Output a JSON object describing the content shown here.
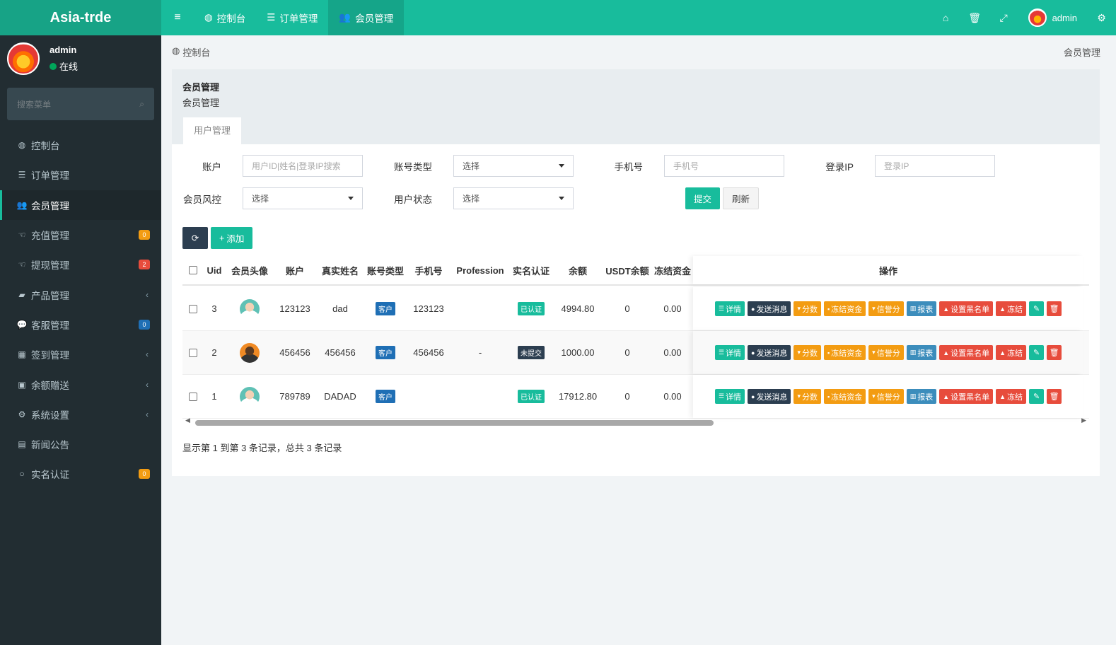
{
  "app": {
    "brand": "Asia-trde"
  },
  "topnav": {
    "tabs": [
      {
        "icon": "dashboard-icon",
        "label": "控制台"
      },
      {
        "icon": "list-icon",
        "label": "订单管理"
      },
      {
        "icon": "users-icon",
        "label": "会员管理"
      }
    ],
    "user": "admin"
  },
  "sidebar": {
    "user": {
      "name": "admin",
      "status": "在线"
    },
    "search_placeholder": "搜索菜单",
    "items": [
      {
        "label": "控制台",
        "icon": "dashboard-icon"
      },
      {
        "label": "订单管理",
        "icon": "list-icon"
      },
      {
        "label": "会员管理",
        "icon": "users-icon",
        "active": true
      },
      {
        "label": "充值管理",
        "icon": "hand-icon",
        "badge": "0",
        "badge_color": "#f39c12"
      },
      {
        "label": "提现管理",
        "icon": "hand-icon",
        "badge": "2",
        "badge_color": "#e74c3c"
      },
      {
        "label": "产品管理",
        "icon": "briefcase-icon",
        "caret": true
      },
      {
        "label": "客服管理",
        "icon": "comments-icon",
        "badge": "0",
        "badge_color": "#1f6fb5"
      },
      {
        "label": "签到管理",
        "icon": "calendar-icon",
        "caret": true
      },
      {
        "label": "余额赠送",
        "icon": "gift-icon",
        "caret": true
      },
      {
        "label": "系统设置",
        "icon": "cogs-icon",
        "caret": true
      },
      {
        "label": "新闻公告",
        "icon": "newspaper-icon"
      },
      {
        "label": "实名认证",
        "icon": "circle-icon",
        "badge": "0",
        "badge_color": "#f39c12"
      }
    ]
  },
  "breadcrumb": {
    "home": "控制台",
    "current": "会员管理"
  },
  "panel": {
    "title": "会员管理",
    "subtitle": "会员管理",
    "tab": "用户管理"
  },
  "filters": {
    "account_label": "账户",
    "account_placeholder": "用户ID|姓名|登录IP搜索",
    "account_type_label": "账号类型",
    "account_type_value": "选择",
    "phone_label": "手机号",
    "phone_placeholder": "手机号",
    "login_ip_label": "登录IP",
    "login_ip_placeholder": "登录IP",
    "risk_label": "会员风控",
    "risk_value": "选择",
    "status_label": "用户状态",
    "status_value": "选择",
    "submit": "提交",
    "refresh": "刷新"
  },
  "toolbar": {
    "add": "添加"
  },
  "table": {
    "headers": [
      "Uid",
      "会员头像",
      "账户",
      "真实姓名",
      "账号类型",
      "手机号",
      "Profession",
      "实名认证",
      "余额",
      "USDT余额",
      "冻结资金",
      "操作"
    ],
    "rows": [
      {
        "uid": "3",
        "avatar": "a",
        "account": "123123",
        "name": "dad",
        "type": "客户",
        "phone": "123123",
        "profession": "",
        "verify": "已认证",
        "verify_style": "green",
        "balance": "4994.80",
        "usdt": "0",
        "frozen": "0.00"
      },
      {
        "uid": "2",
        "avatar": "b",
        "account": "456456",
        "name": "456456",
        "type": "客户",
        "phone": "456456",
        "profession": "-",
        "verify": "未提交",
        "verify_style": "dark",
        "balance": "1000.00",
        "usdt": "0",
        "frozen": "0.00"
      },
      {
        "uid": "1",
        "avatar": "a",
        "account": "789789",
        "name": "DADAD",
        "type": "客户",
        "phone": "",
        "profession": "",
        "verify": "已认证",
        "verify_style": "green",
        "balance": "17912.80",
        "usdt": "0",
        "frozen": "0.00"
      }
    ],
    "actions": [
      {
        "label": "详情",
        "style": "teal",
        "icon": "list-icon"
      },
      {
        "label": "发送消息",
        "style": "navy",
        "icon": "comment-icon"
      },
      {
        "label": "分数",
        "style": "orange",
        "icon": "cart-icon"
      },
      {
        "label": "冻结资金",
        "style": "orange",
        "icon": "lock-icon"
      },
      {
        "label": "信誉分",
        "style": "orange",
        "icon": "cart-icon"
      },
      {
        "label": "报表",
        "style": "blue",
        "icon": "chart-icon"
      },
      {
        "label": "设置黑名单",
        "style": "red",
        "icon": "user-icon"
      },
      {
        "label": "冻结",
        "style": "red",
        "icon": "user-icon"
      }
    ]
  },
  "footer": "显示第 1 到第 3 条记录，总共 3 条记录"
}
